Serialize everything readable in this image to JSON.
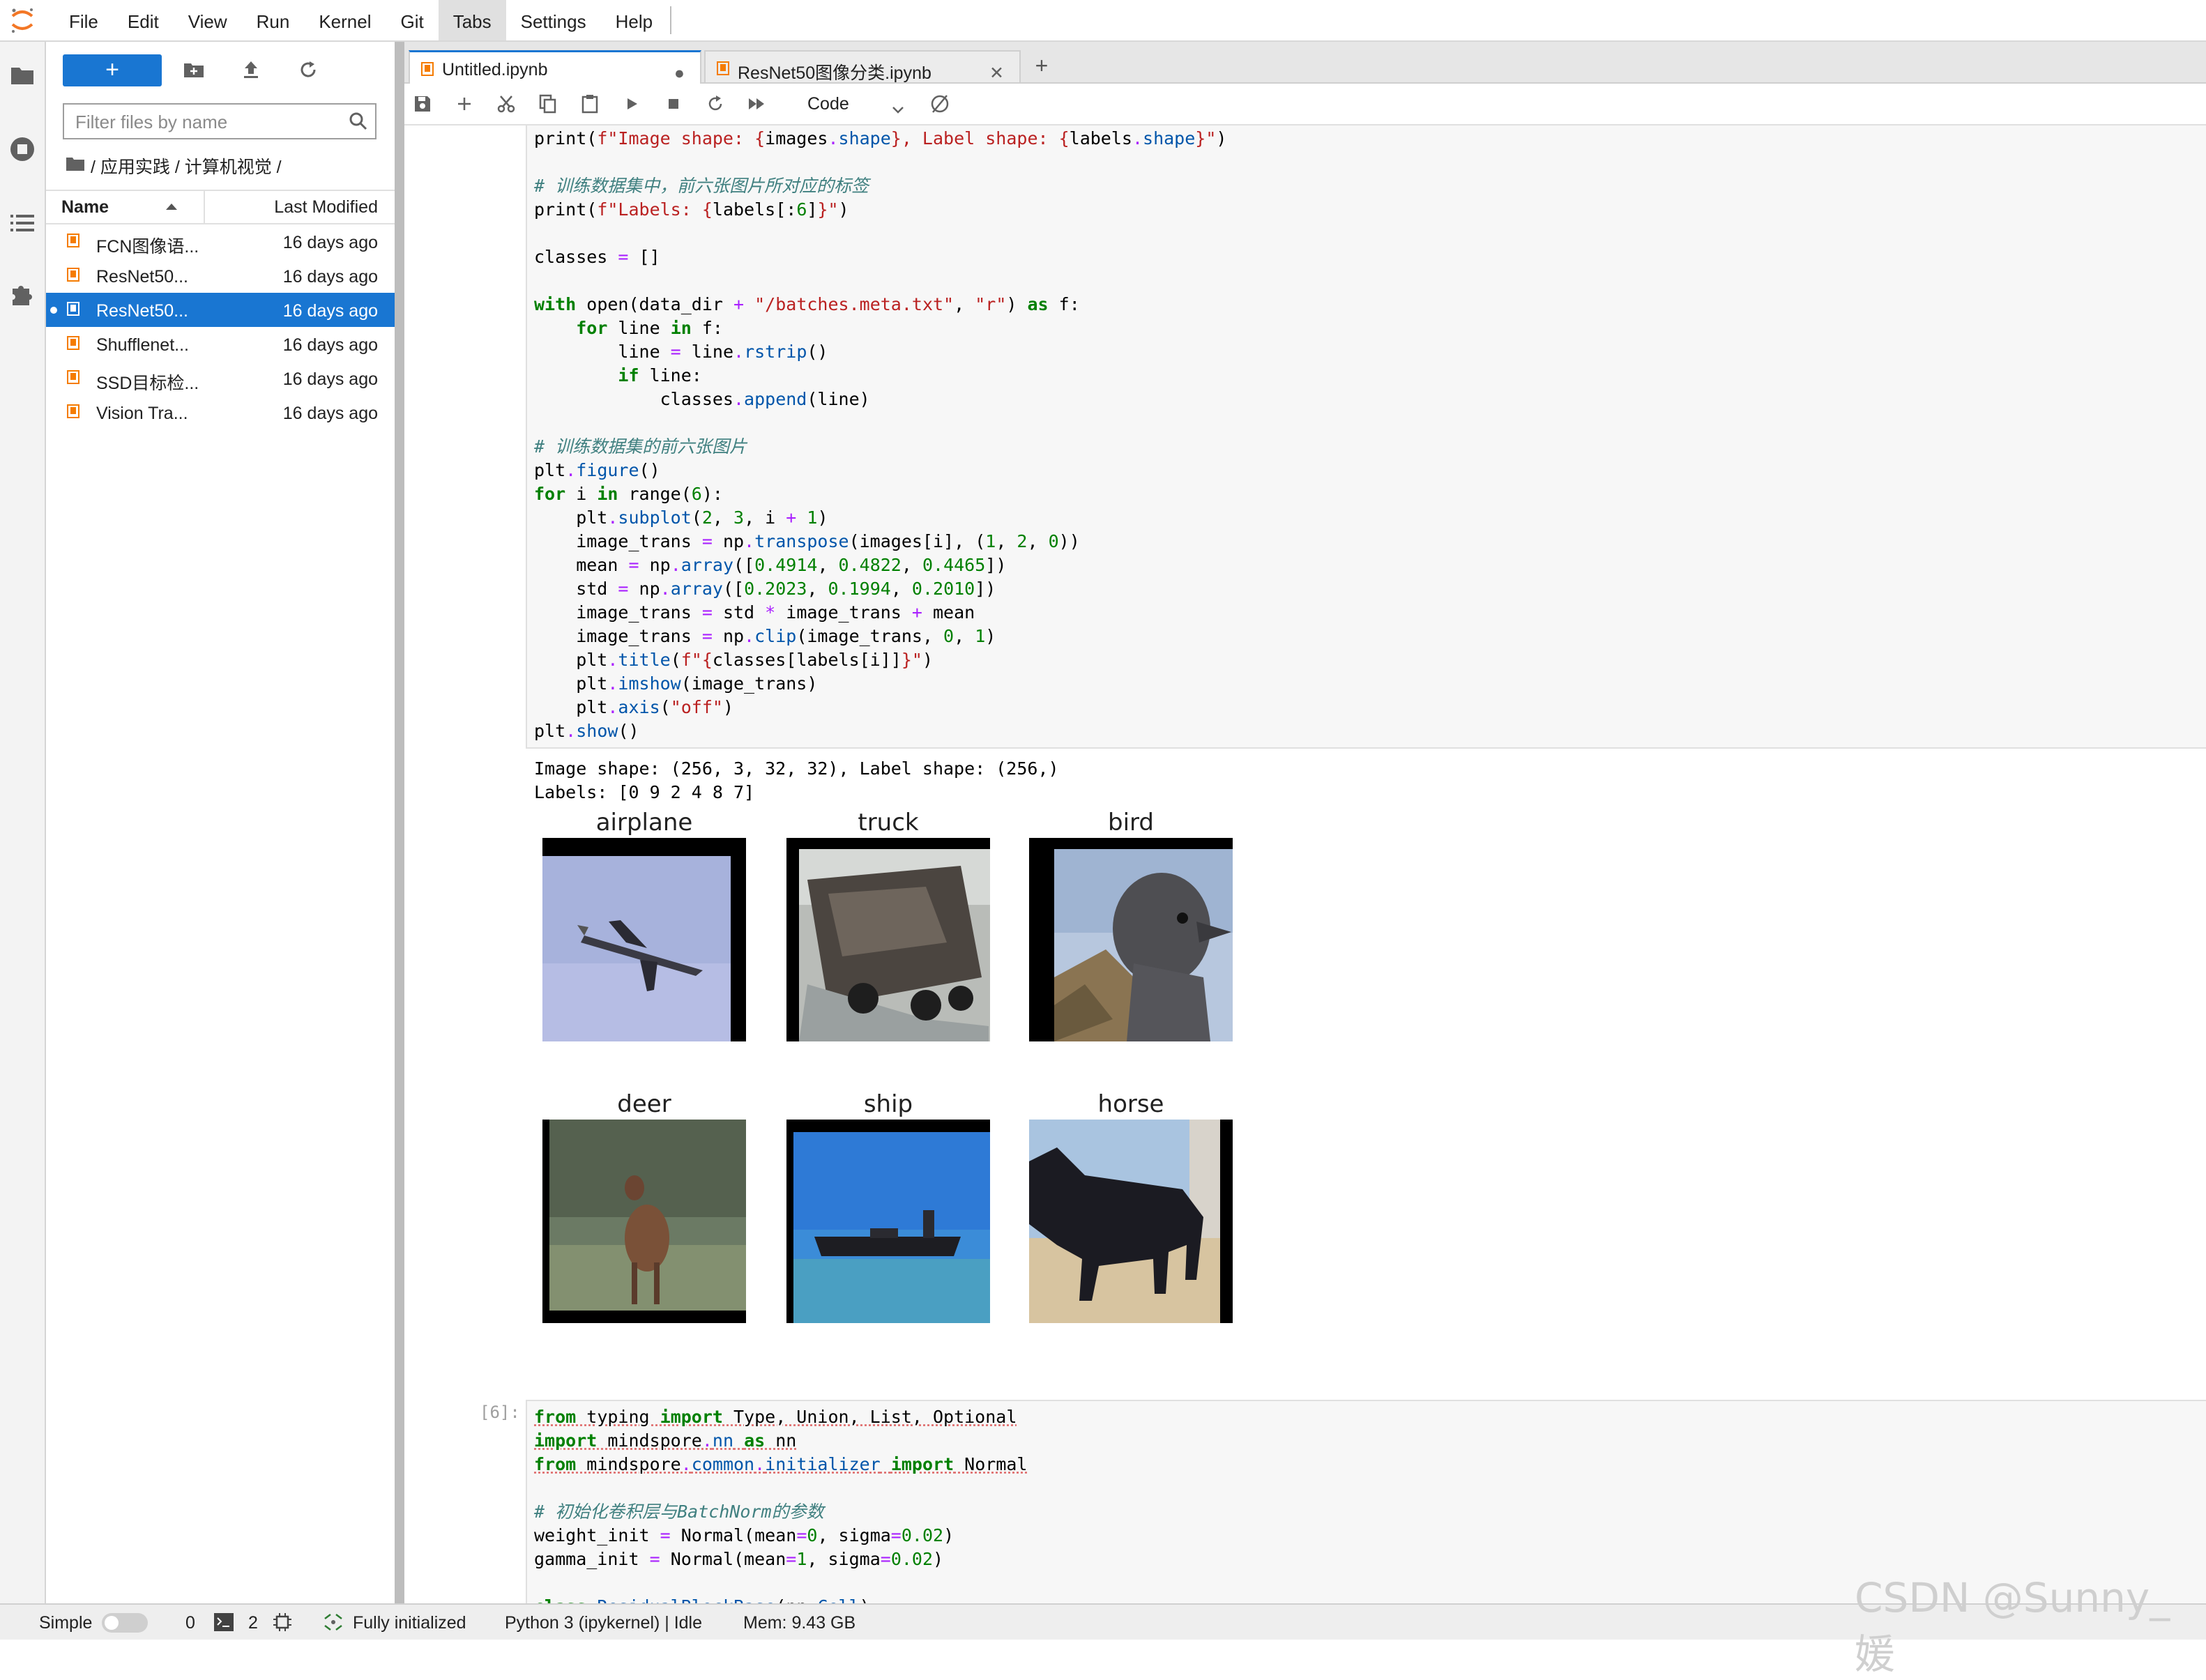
{
  "menubar": {
    "items": [
      "File",
      "Edit",
      "View",
      "Run",
      "Kernel",
      "Git",
      "Tabs",
      "Settings",
      "Help"
    ]
  },
  "filebrowser": {
    "new_label": "+",
    "filter_placeholder": "Filter files by name",
    "breadcrumb": "/ 应用实践 / 计算机视觉 /",
    "col_name": "Name",
    "col_modified": "Last Modified",
    "files": [
      {
        "name": "FCN图像语...",
        "modified": "16 days ago"
      },
      {
        "name": "ResNet50...",
        "modified": "16 days ago"
      },
      {
        "name": "ResNet50...",
        "modified": "16 days ago"
      },
      {
        "name": "Shufflenet...",
        "modified": "16 days ago"
      },
      {
        "name": "SSD目标检...",
        "modified": "16 days ago"
      },
      {
        "name": "Vision Tra...",
        "modified": "16 days ago"
      }
    ]
  },
  "tabs": [
    {
      "label": "Untitled.ipynb",
      "status": "●"
    },
    {
      "label": "ResNet50图像分类.ipynb",
      "status": "✕"
    }
  ],
  "toolbar": {
    "cell_type": "Code"
  },
  "cell1": {
    "output_lines": [
      "Image shape: (256, 3, 32, 32), Label shape: (256,)",
      "Labels: [0 9 2 4 8 7]"
    ],
    "figure_titles": [
      "airplane",
      "truck",
      "bird",
      "deer",
      "ship",
      "horse"
    ]
  },
  "cell2": {
    "prompt": "[6]:"
  },
  "statusbar": {
    "mode": "Simple",
    "terminals": "0",
    "kernels": "2",
    "init_status": "Fully initialized",
    "kernel_status": "Python 3 (ipykernel) | Idle",
    "memory": "Mem: 9.43 GB"
  },
  "watermark": "CSDN @Sunny_媛"
}
